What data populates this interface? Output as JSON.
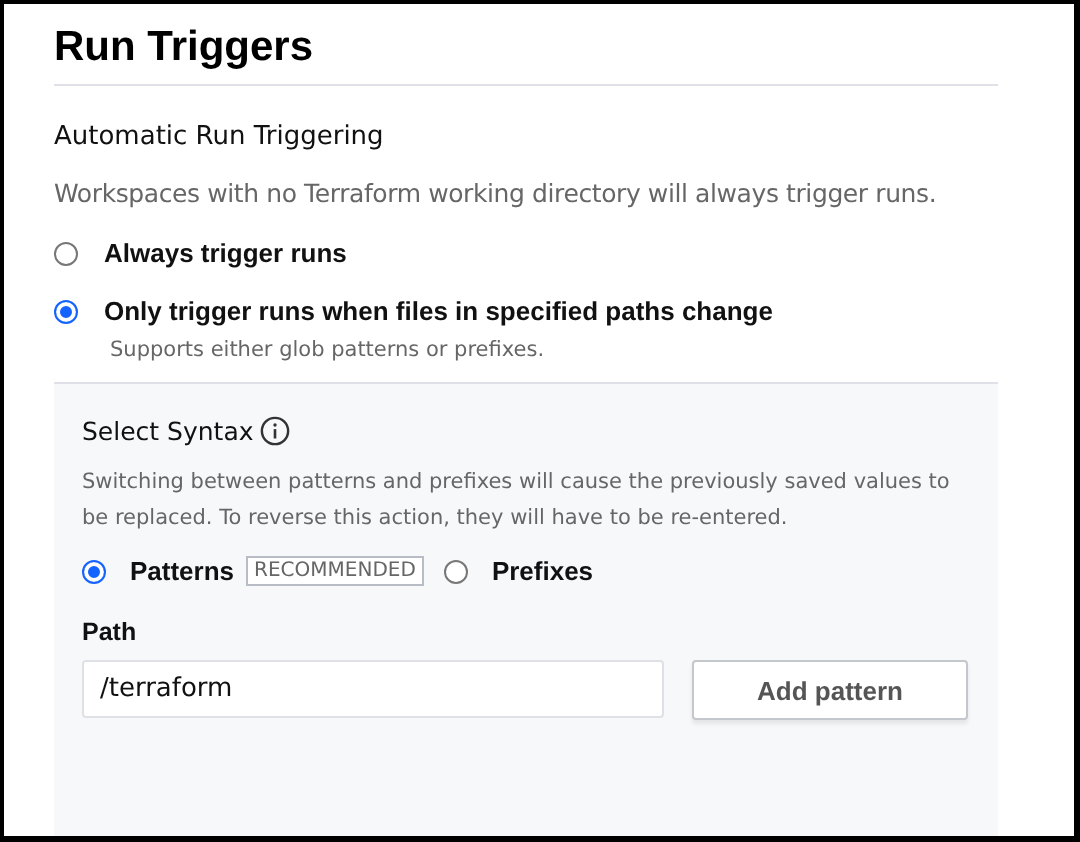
{
  "title": "Run Triggers",
  "section": {
    "heading": "Automatic Run Triggering",
    "description": "Workspaces with no Terraform working directory will always trigger runs."
  },
  "trigger_options": [
    {
      "label": "Always trigger runs",
      "selected": false
    },
    {
      "label": "Only trigger runs when files in specified paths change",
      "hint": "Supports either glob patterns or prefixes.",
      "selected": true
    }
  ],
  "syntax_panel": {
    "heading": "Select Syntax",
    "description": "Switching between patterns and prefixes will cause the previously saved values to be replaced. To reverse this action, they will have to be re-entered.",
    "options": [
      {
        "label": "Patterns",
        "badge": "RECOMMENDED",
        "selected": true
      },
      {
        "label": "Prefixes",
        "selected": false
      }
    ],
    "path_label": "Path",
    "path_value": "/terraform",
    "add_button": "Add pattern"
  }
}
